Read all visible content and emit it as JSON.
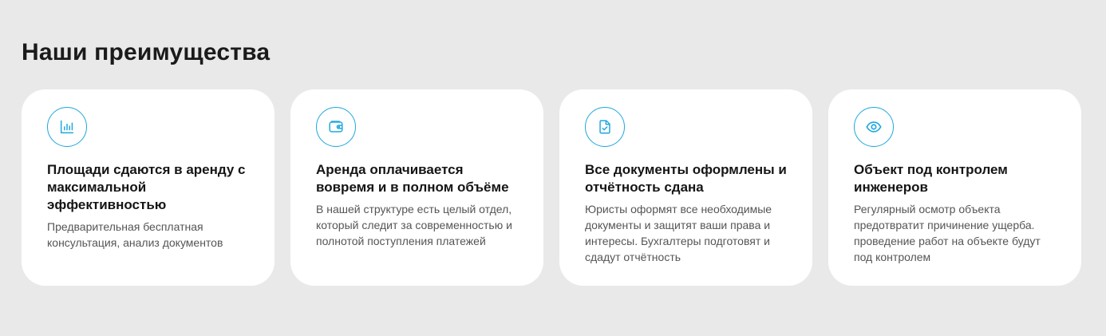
{
  "section": {
    "title": "Наши преимущества"
  },
  "accent_color": "#1ea7dd",
  "cards": [
    {
      "icon": "bar-chart-icon",
      "title": "Площади сдаются в аренду с максимальной эффективностью",
      "text": "Предварительная бесплатная консультация, анализ документов"
    },
    {
      "icon": "wallet-icon",
      "title": "Аренда оплачивается вовремя и в полном объёме",
      "text": "В нашей структуре есть целый отдел, который следит за современностью и полнотой поступления платежей"
    },
    {
      "icon": "document-check-icon",
      "title": "Все документы оформлены и отчётность сдана",
      "text": "Юристы оформят все необходимые документы и защитят ваши права и интересы. Бухгалтеры подготовят и сдадут отчётность"
    },
    {
      "icon": "eye-icon",
      "title": "Объект под контролем инженеров",
      "text": "Регулярный осмотр объекта предотвратит причинение ущерба. проведение работ на объекте будут под контролем"
    }
  ]
}
